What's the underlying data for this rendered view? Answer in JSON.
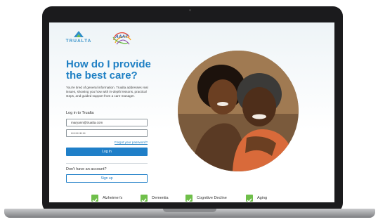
{
  "brand": {
    "trualta_logo_text": "TRUALTA",
    "aaa_logo_text": "AAA7"
  },
  "hero": {
    "heading": "How do I provide the best care?",
    "intro": "You're tired of general information. Trualta addresses real issues, showing you how with in-depth lessons, practical steps, and guided support from a care manager."
  },
  "login": {
    "title": "Log in to Trualta",
    "email_value": "maryann@trualta.com",
    "password_value": "••••••••••",
    "forgot_label": "Forgot your password?",
    "login_button": "Log in"
  },
  "signup": {
    "prompt": "Don't have an account?",
    "button": "Sign up"
  },
  "topics": [
    {
      "label": "Alzheimer's"
    },
    {
      "label": "Dementia"
    },
    {
      "label": "Cognitive Decline"
    },
    {
      "label": "Aging"
    }
  ],
  "colors": {
    "accent": "#1f80c4",
    "check": "#6fbf4a",
    "laptop_frame": "#1b1b1d"
  }
}
